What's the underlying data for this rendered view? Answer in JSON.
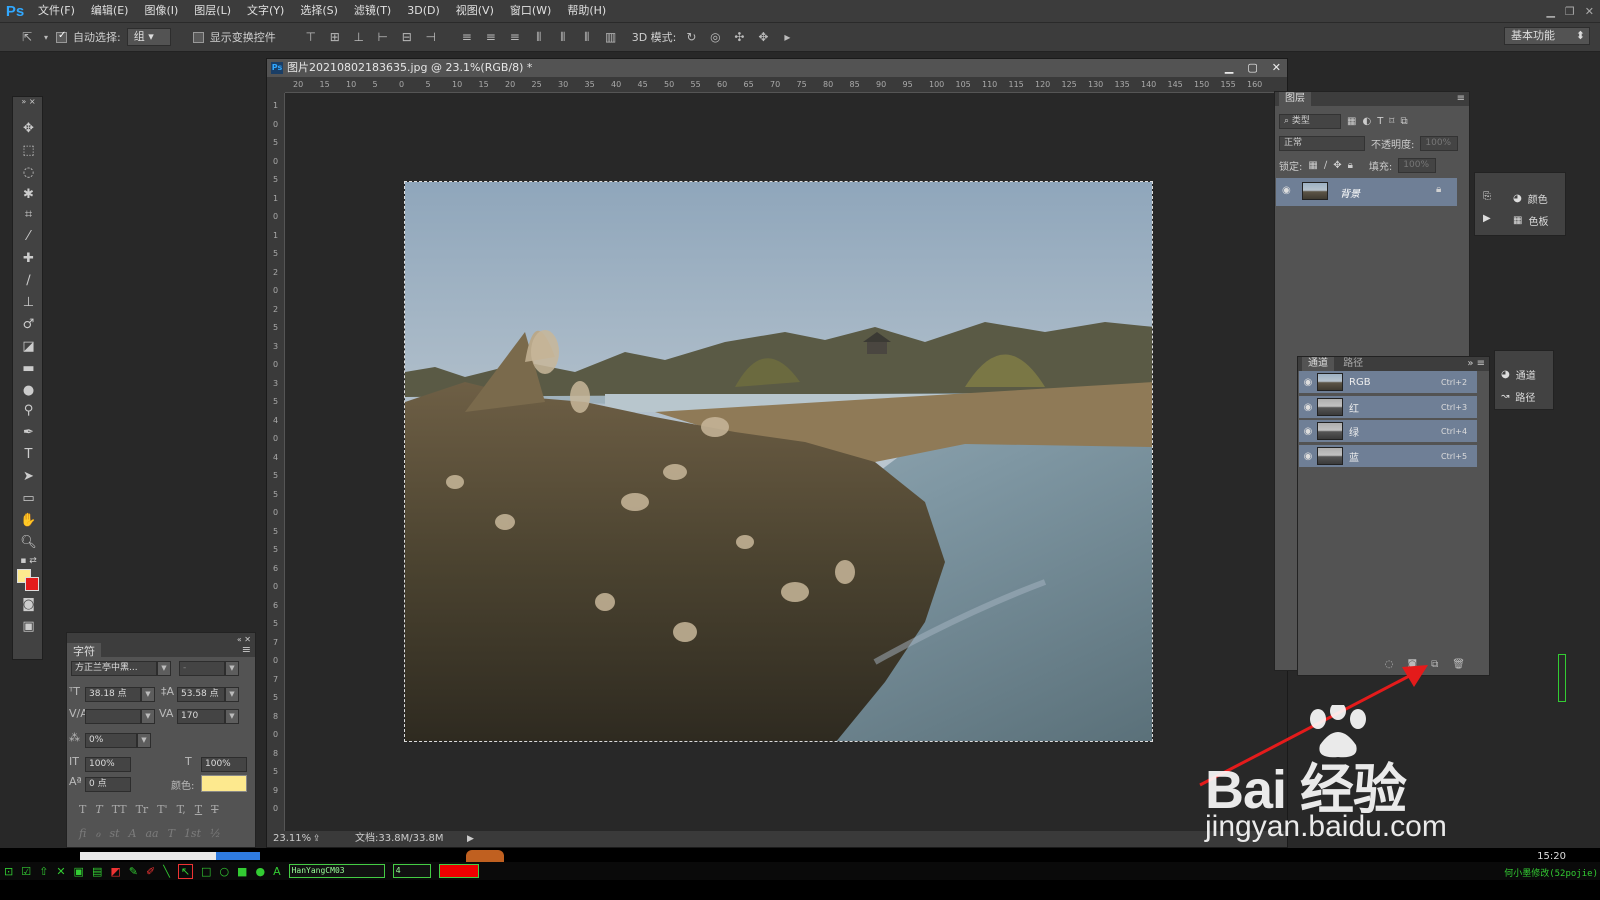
{
  "app": {
    "logo": "Ps"
  },
  "menu": [
    "文件(F)",
    "编辑(E)",
    "图像(I)",
    "图层(L)",
    "文字(Y)",
    "选择(S)",
    "滤镜(T)",
    "3D(D)",
    "视图(V)",
    "窗口(W)",
    "帮助(H)"
  ],
  "options": {
    "auto_select_label": "自动选择:",
    "auto_select_checked": true,
    "group_value": "组",
    "show_transform_label": "显示变换控件",
    "show_transform_checked": false,
    "mode3d_label": "3D 模式:",
    "workspace": "基本功能"
  },
  "document": {
    "title": "图片20210802183635.jpg @ 23.1%(RGB/8) *",
    "ruler_h": [
      "20",
      "15",
      "10",
      "5",
      "0",
      "5",
      "10",
      "15",
      "20",
      "25",
      "30",
      "35",
      "40",
      "45",
      "50",
      "55",
      "60",
      "65",
      "70",
      "75",
      "80",
      "85",
      "90",
      "95",
      "100",
      "105",
      "110",
      "115",
      "120",
      "125",
      "130",
      "135",
      "140",
      "145",
      "150",
      "155",
      "160"
    ],
    "ruler_v": [
      "1",
      "0",
      "5",
      "0",
      "5",
      "1",
      "0",
      "1",
      "5",
      "2",
      "0",
      "2",
      "5",
      "3",
      "0",
      "3",
      "5",
      "4",
      "0",
      "4",
      "5",
      "5",
      "0",
      "5",
      "5",
      "6",
      "0",
      "6",
      "5",
      "7",
      "0",
      "7",
      "5",
      "8",
      "0",
      "8",
      "5",
      "9",
      "0"
    ],
    "zoom": "23.11%",
    "doc_size": "文档:33.8M/33.8M"
  },
  "layers_panel": {
    "tab": "图层",
    "filter_label": "类型",
    "blend_mode": "正常",
    "opacity_label": "不透明度:",
    "opacity_value": "100%",
    "lock_label": "锁定:",
    "fill_label": "填充:",
    "fill_value": "100%",
    "layer_name": "背景"
  },
  "mini_panel_1": {
    "item1": "颜色",
    "item2": "色板"
  },
  "mini_panel_2": {
    "item1": "通道",
    "item2": "路径"
  },
  "channels_panel": {
    "tabs": [
      "通道",
      "路径"
    ],
    "rows": [
      {
        "name": "RGB",
        "shortcut": "Ctrl+2"
      },
      {
        "name": "红",
        "shortcut": "Ctrl+3"
      },
      {
        "name": "绿",
        "shortcut": "Ctrl+4"
      },
      {
        "name": "蓝",
        "shortcut": "Ctrl+5"
      }
    ]
  },
  "char_panel": {
    "tab": "字符",
    "font_family": "方正兰亭中黑...",
    "font_style": "-",
    "font_size": "38.18 点",
    "leading": "53.58 点",
    "kerning": "",
    "tracking": "170",
    "scale_pct": "0%",
    "vscale": "100%",
    "hscale": "100%",
    "baseline": "0 点",
    "color_label": "颜色:",
    "color": "#fde98e",
    "styles": [
      "T",
      "T",
      "TT",
      "Tr",
      "T'",
      "T,",
      "T",
      "T"
    ],
    "opentype": [
      "fi",
      "ℴ",
      "st",
      "A",
      "aa",
      "T",
      "1st",
      "½"
    ]
  },
  "taskbar": {
    "font_name": "HanYangCM03",
    "size": "4",
    "clock": "15:20",
    "credit": "何小墨修改(52pojie)"
  },
  "watermark": {
    "big": "Bai  经验",
    "small": "jingyan.baidu.com"
  },
  "colors": {
    "accent": "#31a8ff",
    "arrow": "#e41b1b",
    "selected_row": "#6f7f96"
  }
}
